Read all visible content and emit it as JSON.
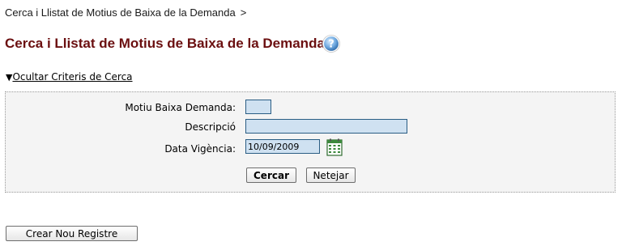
{
  "breadcrumb": {
    "current": "Cerca i Llistat de Motius de Baixa de la Demanda",
    "separator": ">"
  },
  "page": {
    "title": "Cerca i Llistat de Motius de Baixa de la Demanda",
    "help_icon": "help-icon"
  },
  "search": {
    "toggle_label": "Ocultar Criteris de Cerca",
    "fields": {
      "motiu_label": "Motiu Baixa Demanda:",
      "motiu_value": "",
      "descripcio_label": "Descripció",
      "descripcio_value": "",
      "data_label": "Data Vigència:",
      "data_value": "10/09/2009",
      "calendar_icon": "calendar-icon"
    },
    "buttons": {
      "search": "Cercar",
      "clear": "Netejar"
    }
  },
  "actions": {
    "create": "Crear Nou Registre"
  },
  "colors": {
    "title": "#6b0f10",
    "input_bg": "#cfe1f1",
    "input_border": "#2a5d84",
    "panel_bg": "#f4f4f4"
  }
}
